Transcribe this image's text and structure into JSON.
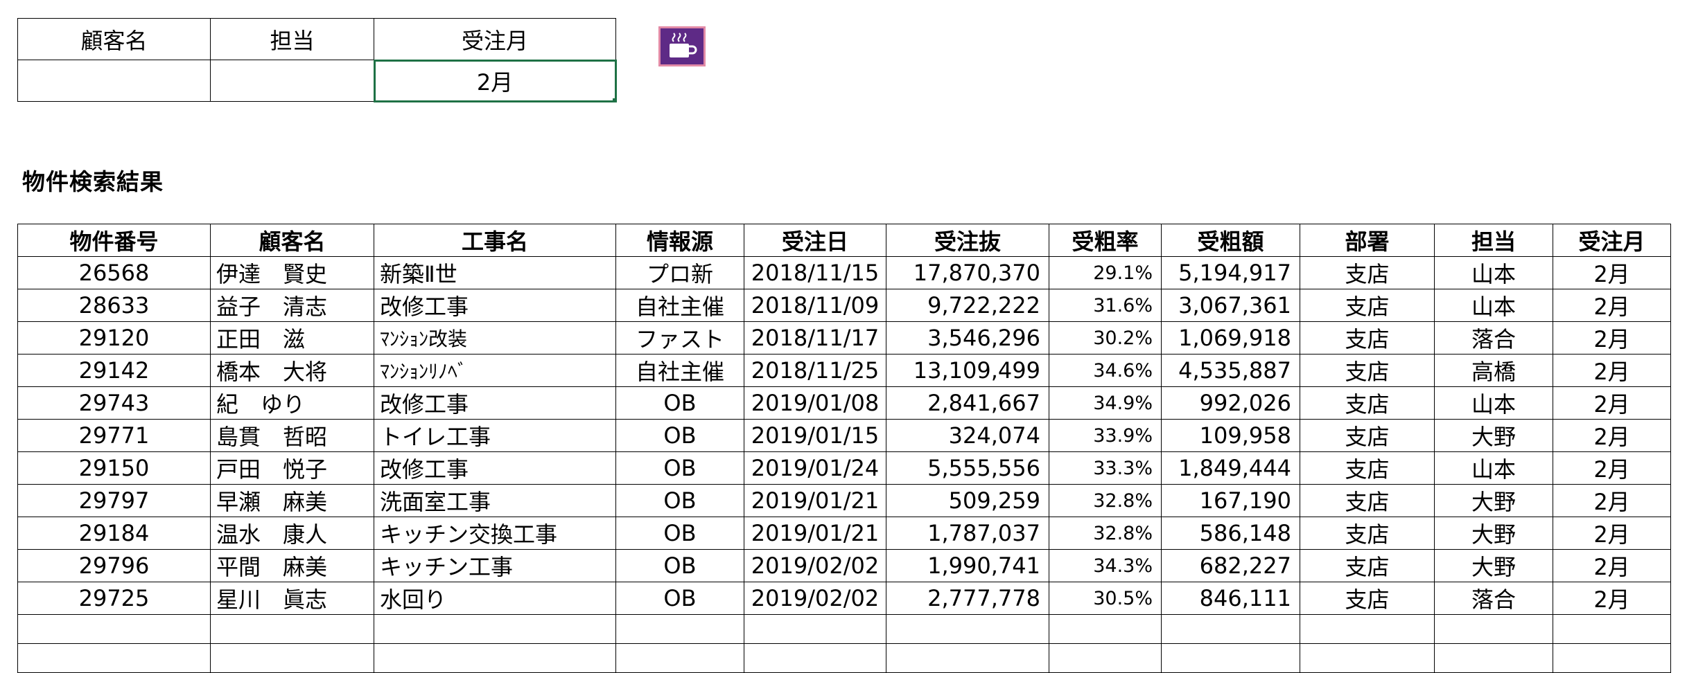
{
  "criteria": {
    "headers": [
      "顧客名",
      "担当",
      "受注月"
    ],
    "values": [
      "",
      "",
      "2月"
    ]
  },
  "macro_button": {
    "icon": "coffee-cup-icon",
    "color": "#5e2a86"
  },
  "section_title": "物件検索結果",
  "results": {
    "headers": [
      "物件番号",
      "顧客名",
      "工事名",
      "情報源",
      "受注日",
      "受注抜",
      "受粗率",
      "受粗額",
      "部署",
      "担当",
      "受注月"
    ],
    "rows": [
      [
        "26568",
        "伊達　賢史",
        "新築Ⅱ世",
        "プロ新",
        "2018/11/15",
        "17,870,370",
        "29.1%",
        "5,194,917",
        "支店",
        "山本",
        "2月"
      ],
      [
        "28633",
        "益子　清志",
        "改修工事",
        "自社主催",
        "2018/11/09",
        "9,722,222",
        "31.6%",
        "3,067,361",
        "支店",
        "山本",
        "2月"
      ],
      [
        "29120",
        "正田　滋",
        "ﾏﾝｼｮﾝ改装",
        "ファスト",
        "2018/11/17",
        "3,546,296",
        "30.2%",
        "1,069,918",
        "支店",
        "落合",
        "2月"
      ],
      [
        "29142",
        "橋本　大将",
        "ﾏﾝｼｮﾝﾘﾉﾍﾞ",
        "自社主催",
        "2018/11/25",
        "13,109,499",
        "34.6%",
        "4,535,887",
        "支店",
        "高橋",
        "2月"
      ],
      [
        "29743",
        "紀　ゆり",
        "改修工事",
        "OB",
        "2019/01/08",
        "2,841,667",
        "34.9%",
        "992,026",
        "支店",
        "山本",
        "2月"
      ],
      [
        "29771",
        "島貫　哲昭",
        "トイレ工事",
        "OB",
        "2019/01/15",
        "324,074",
        "33.9%",
        "109,958",
        "支店",
        "大野",
        "2月"
      ],
      [
        "29150",
        "戸田　悦子",
        "改修工事",
        "OB",
        "2019/01/24",
        "5,555,556",
        "33.3%",
        "1,849,444",
        "支店",
        "山本",
        "2月"
      ],
      [
        "29797",
        "早瀬　麻美",
        "洗面室工事",
        "OB",
        "2019/01/21",
        "509,259",
        "32.8%",
        "167,190",
        "支店",
        "大野",
        "2月"
      ],
      [
        "29184",
        "温水　康人",
        "キッチン交換工事",
        "OB",
        "2019/01/21",
        "1,787,037",
        "32.8%",
        "586,148",
        "支店",
        "大野",
        "2月"
      ],
      [
        "29796",
        "平間　麻美",
        "キッチン工事",
        "OB",
        "2019/02/02",
        "1,990,741",
        "34.3%",
        "682,227",
        "支店",
        "大野",
        "2月"
      ],
      [
        "29725",
        "星川　眞志",
        "水回り",
        "OB",
        "2019/02/02",
        "2,777,778",
        "30.5%",
        "846,111",
        "支店",
        "落合",
        "2月"
      ]
    ]
  }
}
